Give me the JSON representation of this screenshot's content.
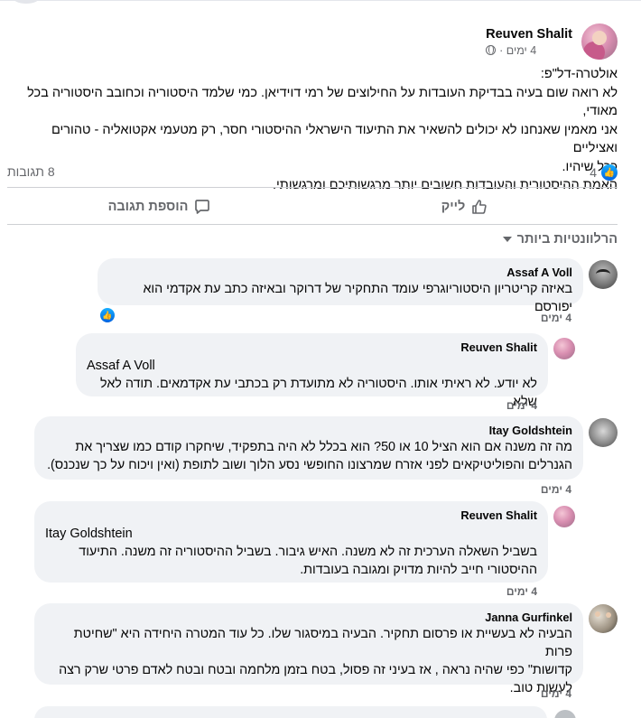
{
  "post": {
    "author": "Reuven Shalit",
    "time": "4 ימים ·",
    "lines": [
      "אולטרה-דל\"פ:",
      "לא רואה שום בעיה בבדיקת העובדות על החילוצים של רמי דוידיאן. כמי שלמד היסטוריה וכחובב היסטוריה בכל מאודי,",
      "אני מאמין שאנחנו לא יכולים להשאיר את התיעוד הישראלי ההיסטורי חסר, רק מטעמי אקטואליה - טהורים ואציליים",
      "ככל שיהיו.",
      "האמת ההיסטורית והעובדות חשובים יותר מרגשותיכם ומרגשותי."
    ]
  },
  "reactions": {
    "count": "4",
    "comments": "8 תגובות"
  },
  "actions": {
    "like": "לייק",
    "comment": "הוספת תגובה"
  },
  "sort_label": "הרלוונטיות ביותר",
  "comments": [
    {
      "name": "Assaf A Voll",
      "text": "באיזה קריטריון היסטוריוגרפי עומד התחקיר של דרוקר ובאיזה כתב עת אקדמי הוא יפורסם",
      "time": "4 ימים"
    },
    {
      "name": "Reuven Shalit",
      "mention": "Assaf A Voll",
      "text": "לא יודע. לא ראיתי אותו. היסטוריה לא מתועדת רק בכתבי עת אקדמאים. תודה לאל שלא",
      "time": "4 ימים"
    },
    {
      "name": "Itay Goldshtein",
      "lines": [
        "מה זה משנה אם הוא הציל 10 או 50? הוא בכלל לא היה בתפקיד, שיחקרו קודם כמו שצריך את",
        "הגנרלים והפוליטיקאים לפני אזרח שמרצונו החופשי נסע הלוך ושוב לתופת (ואין ויכוח על כך שנכנס)."
      ],
      "time": "4 ימים"
    },
    {
      "name": "Reuven Shalit",
      "mention": "Itay Goldshtein",
      "lines": [
        "בשביל השאלה הערכית זה לא משנה. האיש גיבור. בשביל ההיסטוריה זה משנה. התיעוד",
        "ההיסטורי חייב להיות מדויק ומגובה בעובדות."
      ],
      "time": "4 ימים"
    },
    {
      "name": "Janna Gurfinkel",
      "lines": [
        "הבעיה לא בעשיית או פרסום תחקיר. הבעיה במיסגור שלו. כל עוד המטרה היחידה היא \"שחיטת פרות",
        "קדושות\" כפי שהיה נראה , אז בעיני זה פסול, בטח בזמן מלחמה ובטח ובטח לאדם פרטי שרק רצה",
        "לעשות טוב."
      ],
      "time": "4 ימים"
    }
  ],
  "icons": {
    "globe": "globe-icon",
    "like": "thumbs-up-icon",
    "comment": "comment-bubble-icon",
    "caret": "caret-down-icon"
  },
  "colors": {
    "accent": "#0866ff",
    "muted": "#65676b",
    "bubble": "#f0f2f5"
  }
}
